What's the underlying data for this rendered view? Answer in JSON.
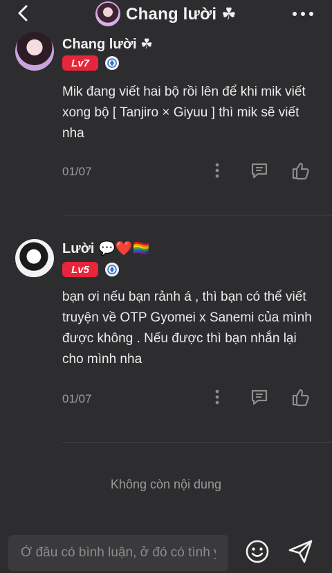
{
  "header": {
    "title": "Chang lười ☘",
    "back_icon": "chevron-left-icon",
    "more_icon": "more-horizontal-icon"
  },
  "comments": [
    {
      "username": "Chang lười ☘",
      "level": "Lv7",
      "text": "Mik đang viết hai bộ rồi lên để khi mik viết xong bộ [ Tanjiro × Giyuu ] thì mik sẽ viết nha",
      "date": "01/07"
    },
    {
      "username": "Lười 💬❤️🏳️‍🌈",
      "level": "Lv5",
      "text": "bạn ơi nếu bạn rảnh á , thì bạn có thể viết truyện về OTP Gyomei x Sanemi của mình được không . Nếu được thì bạn nhắn lại cho mình nha",
      "date": "01/07"
    }
  ],
  "end_note": "Không còn nội dung",
  "input": {
    "placeholder": "Ở đâu có bình luận, ở đó có tình yêu"
  },
  "colors": {
    "background": "#2d2d2f",
    "level_badge": "#e8253b",
    "verified_badge": "#2f6fd6"
  }
}
